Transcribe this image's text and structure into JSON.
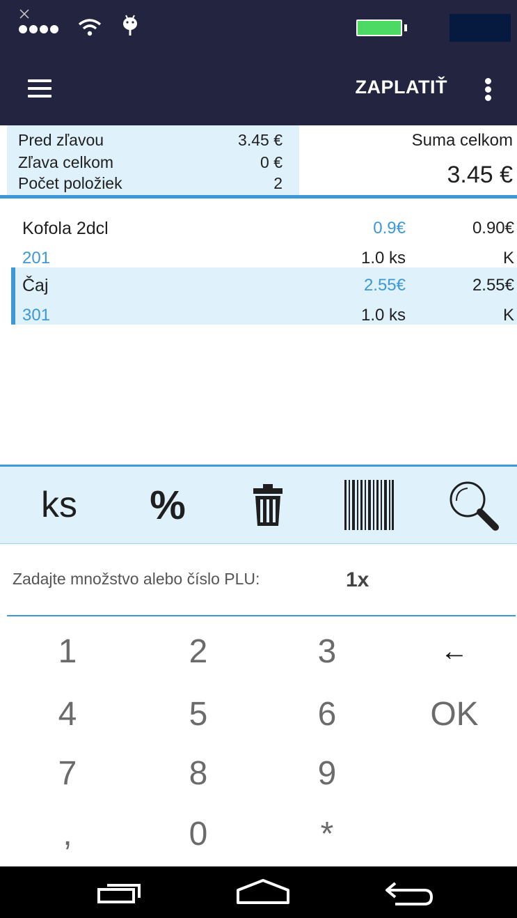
{
  "app_bar": {
    "pay_label": "ZAPLATIŤ",
    "menu_icon": "hamburger-menu-icon",
    "overflow_icon": "more-vert-icon"
  },
  "summary": {
    "before_discount_label": "Pred zľavou",
    "before_discount_value": "3.45 €",
    "discount_label": "Zľava celkom",
    "discount_value": "0 €",
    "count_label": "Počet položiek",
    "count_value": "2",
    "total_label": "Suma celkom",
    "total_value": "3.45 €"
  },
  "items": [
    {
      "name": "Kofola 2dcl",
      "plu": "201",
      "price": "0.9€",
      "qty": "1.0 ks",
      "total": "0.90€",
      "code": "K"
    },
    {
      "name": "Čaj",
      "plu": "301",
      "price": "2.55€",
      "qty": "1.0 ks",
      "total": "2.55€",
      "code": "K"
    }
  ],
  "toolbar": {
    "ks_label": "ks",
    "percent_label": "%",
    "delete_icon": "trash-icon",
    "barcode_icon": "barcode-icon",
    "search_icon": "search-icon"
  },
  "input": {
    "prompt": "Zadajte množstvo alebo číslo PLU:",
    "value": "1x"
  },
  "keypad": {
    "k1": "1",
    "k2": "2",
    "k3": "3",
    "back": "←",
    "k4": "4",
    "k5": "5",
    "k6": "6",
    "ok": "OK",
    "k7": "7",
    "k8": "8",
    "k9": "9",
    "comma": ",",
    "k0": "0",
    "star": "*"
  },
  "colors": {
    "appbar": "#232440",
    "accent": "#3d98d8",
    "highlight": "#dff2fb"
  }
}
